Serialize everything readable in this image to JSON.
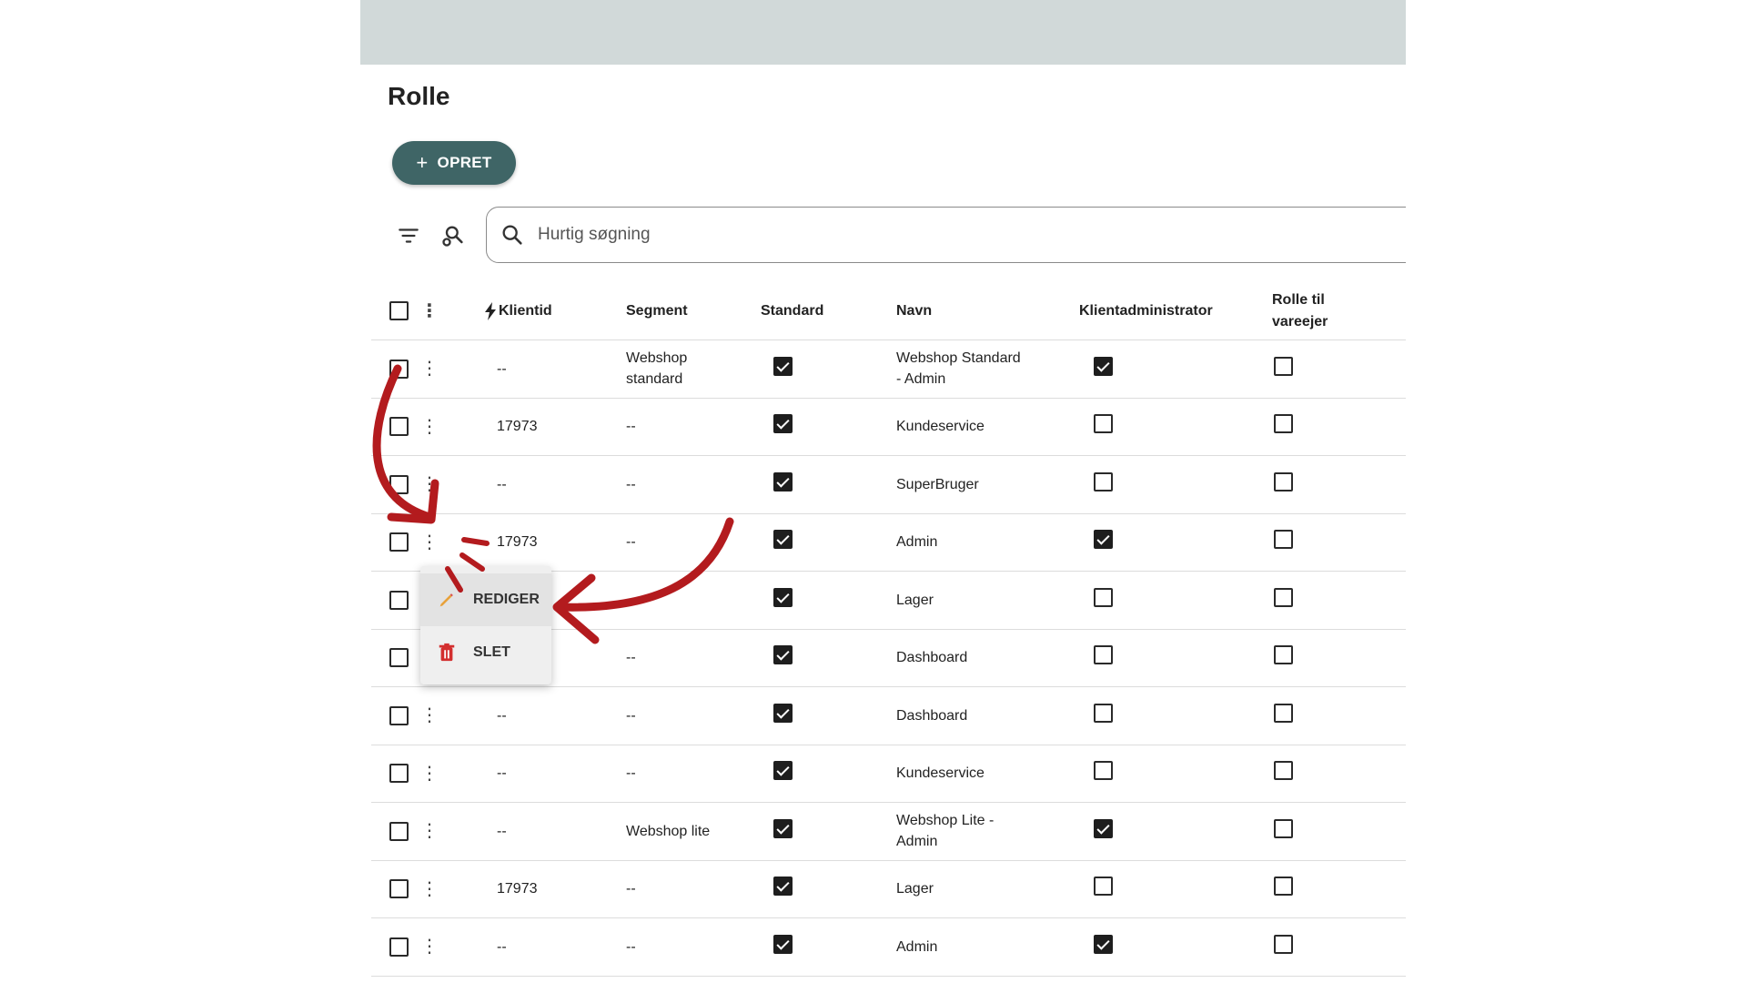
{
  "page": {
    "title": "Rolle"
  },
  "toolbar": {
    "create_label": "OPRET",
    "create_icon": "plus-icon"
  },
  "search": {
    "placeholder": "Hurtig søgning",
    "value": ""
  },
  "table": {
    "columns": {
      "klientid": "Klientid",
      "segment": "Segment",
      "standard": "Standard",
      "navn": "Navn",
      "klientadministrator": "Klientadministrator",
      "rolle_line1": "Rolle til",
      "rolle_line2": "vareejer"
    },
    "rows": [
      {
        "klientid": "--",
        "segment_line1": "Webshop",
        "segment_line2": "standard",
        "standard": true,
        "navn_line1": "Webshop Standard",
        "navn_line2": "- Admin",
        "klientadministrator": true,
        "rolle_til_vareejer": false
      },
      {
        "klientid": "17973",
        "segment_line1": "--",
        "segment_line2": "",
        "standard": true,
        "navn_line1": "Kundeservice",
        "navn_line2": "",
        "klientadministrator": false,
        "rolle_til_vareejer": false
      },
      {
        "klientid": "--",
        "segment_line1": "--",
        "segment_line2": "",
        "standard": true,
        "navn_line1": "SuperBruger",
        "navn_line2": "",
        "klientadministrator": false,
        "rolle_til_vareejer": false
      },
      {
        "klientid": "17973",
        "segment_line1": "--",
        "segment_line2": "",
        "standard": true,
        "navn_line1": "Admin",
        "navn_line2": "",
        "klientadministrator": true,
        "rolle_til_vareejer": false
      },
      {
        "klientid": "",
        "segment_line1": "",
        "segment_line2": "",
        "standard": true,
        "navn_line1": "Lager",
        "navn_line2": "",
        "klientadministrator": false,
        "rolle_til_vareejer": false
      },
      {
        "klientid": "",
        "segment_line1": "--",
        "segment_line2": "",
        "standard": true,
        "navn_line1": "Dashboard",
        "navn_line2": "",
        "klientadministrator": false,
        "rolle_til_vareejer": false
      },
      {
        "klientid": "--",
        "segment_line1": "--",
        "segment_line2": "",
        "standard": true,
        "navn_line1": "Dashboard",
        "navn_line2": "",
        "klientadministrator": false,
        "rolle_til_vareejer": false
      },
      {
        "klientid": "--",
        "segment_line1": "--",
        "segment_line2": "",
        "standard": true,
        "navn_line1": "Kundeservice",
        "navn_line2": "",
        "klientadministrator": false,
        "rolle_til_vareejer": false
      },
      {
        "klientid": "--",
        "segment_line1": "Webshop lite",
        "segment_line2": "",
        "standard": true,
        "navn_line1": "Webshop Lite -",
        "navn_line2": "Admin",
        "klientadministrator": true,
        "rolle_til_vareejer": false
      },
      {
        "klientid": "17973",
        "segment_line1": "--",
        "segment_line2": "",
        "standard": true,
        "navn_line1": "Lager",
        "navn_line2": "",
        "klientadministrator": false,
        "rolle_til_vareejer": false
      },
      {
        "klientid": "--",
        "segment_line1": "--",
        "segment_line2": "",
        "standard": true,
        "navn_line1": "Admin",
        "navn_line2": "",
        "klientadministrator": true,
        "rolle_til_vareejer": false
      }
    ]
  },
  "context_menu": {
    "items": [
      {
        "label": "REDIGER",
        "icon": "pencil-icon"
      },
      {
        "label": "SLET",
        "icon": "trash-icon"
      }
    ]
  },
  "annotation": {
    "color": "#b31b1e"
  }
}
